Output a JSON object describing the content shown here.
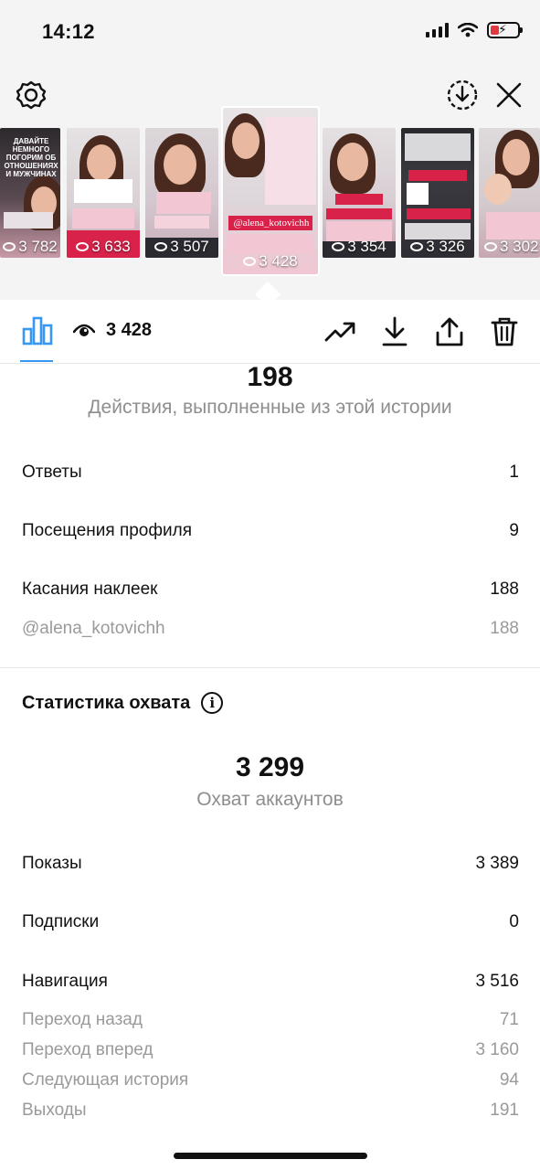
{
  "status_bar": {
    "time": "14:12"
  },
  "stories": [
    {
      "views": "3 782",
      "caption": "ДАВАЙТЕ НЕМНОГО ПОГОРИМ ОБ ОТНОШЕНИЯХ И МУЖЧИНАХ"
    },
    {
      "views": "3 633"
    },
    {
      "views": "3 507"
    },
    {
      "views": "3 428",
      "tag": "@alena_kotovichh"
    },
    {
      "views": "3 354"
    },
    {
      "views": "3 326"
    },
    {
      "views": "3 302"
    }
  ],
  "tabs": {
    "views_count": "3 428"
  },
  "actions": {
    "count": "198",
    "label": "Действия, выполненные из этой истории",
    "rows": [
      {
        "label": "Ответы",
        "value": "1"
      },
      {
        "label": "Посещения профиля",
        "value": "9"
      },
      {
        "label": "Касания наклеек",
        "value": "188"
      }
    ],
    "sub_rows": [
      {
        "label": "@alena_kotovichh",
        "value": "188"
      }
    ]
  },
  "reach": {
    "title": "Статистика охвата",
    "count": "3 299",
    "label": "Охват аккаунтов",
    "rows": [
      {
        "label": "Показы",
        "value": "3 389"
      },
      {
        "label": "Подписки",
        "value": "0"
      },
      {
        "label": "Навигация",
        "value": "3 516"
      }
    ],
    "sub_rows": [
      {
        "label": "Переход назад",
        "value": "71"
      },
      {
        "label": "Переход вперед",
        "value": "3 160"
      },
      {
        "label": "Следующая история",
        "value": "94"
      },
      {
        "label": "Выходы",
        "value": "191"
      }
    ]
  },
  "colors": {
    "accent": "#3897f0",
    "muted": "#8e8e8e",
    "story_red": "#d8224a"
  }
}
